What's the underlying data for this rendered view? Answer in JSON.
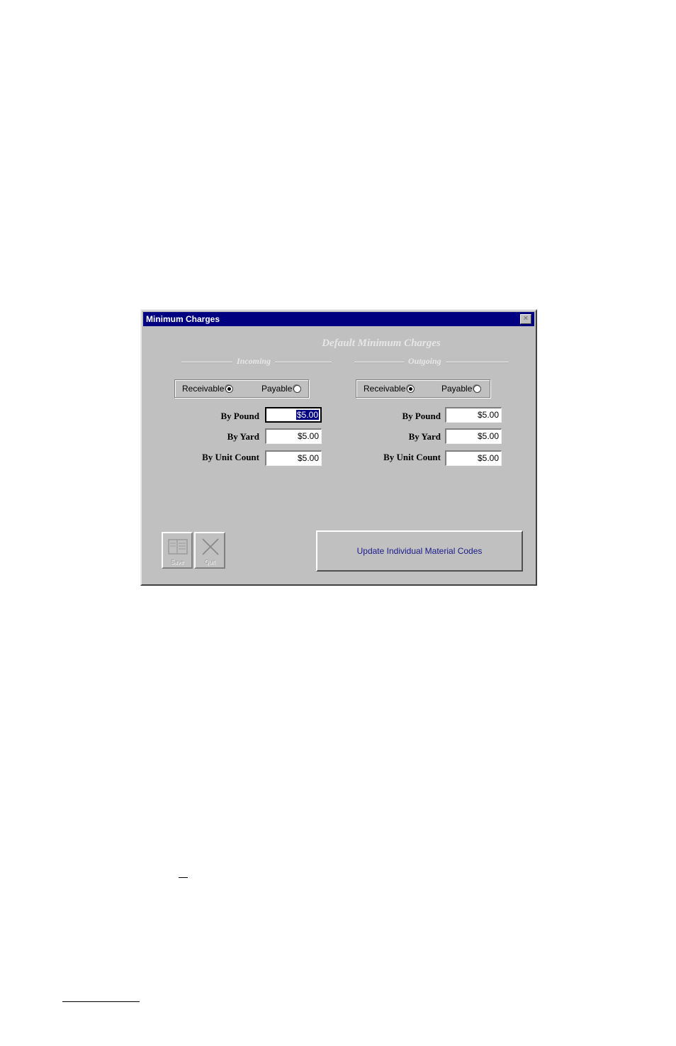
{
  "window": {
    "title": "Minimum Charges",
    "close_glyph": "×"
  },
  "heading": "Default Minimum Charges",
  "sections": [
    {
      "label": "Incoming",
      "receivable_label": "Receivable",
      "payable_label": "Payable",
      "selected": "Receivable",
      "fields": [
        {
          "label": "By Pound",
          "value": "$5.00"
        },
        {
          "label": "By Yard",
          "value": "$5.00"
        },
        {
          "label": "By Unit Count",
          "value": "$5.00"
        }
      ]
    },
    {
      "label": "Outgoing",
      "receivable_label": "Receivable",
      "payable_label": "Payable",
      "selected": "Receivable",
      "fields": [
        {
          "label": "By Pound",
          "value": "$5.00"
        },
        {
          "label": "By Yard",
          "value": "$5.00"
        },
        {
          "label": "By Unit Count",
          "value": "$5.00"
        }
      ]
    }
  ],
  "toolbar": {
    "save_label": "Save",
    "quit_label": "Quit"
  },
  "update_button_label": "Update Individual Material Codes",
  "colors": {
    "titlebar": "#000080",
    "face": "#c0c0c0",
    "button_text": "#1a1a8a"
  }
}
